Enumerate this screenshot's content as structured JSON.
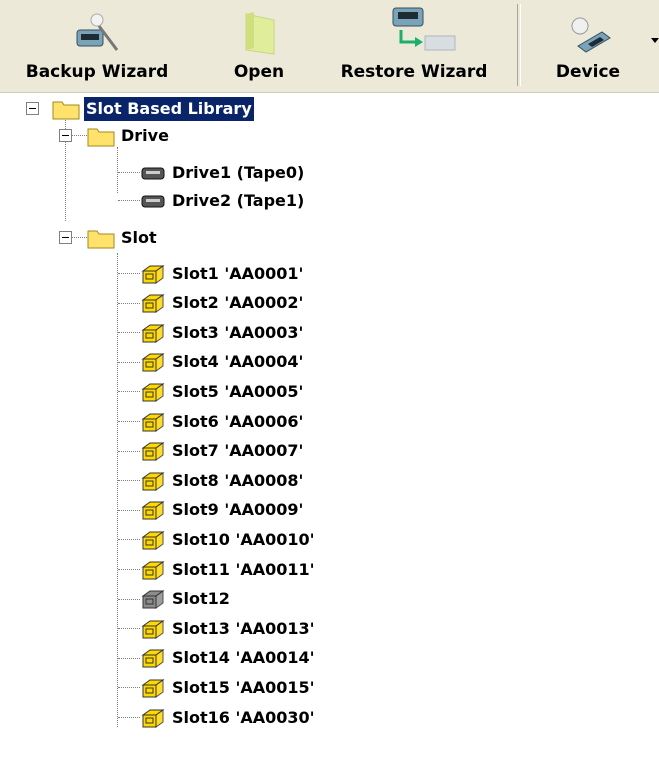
{
  "toolbar": {
    "backup_label": "Backup Wizard",
    "open_label": "Open",
    "restore_label": "Restore Wizard",
    "device_label": "Device"
  },
  "tree": {
    "root": {
      "label": "Slot Based Library",
      "icon": "folder-icon",
      "selected": true
    },
    "drive_group": {
      "label": "Drive",
      "icon": "folder-icon"
    },
    "drives": [
      {
        "label": "Drive1 (Tape0)",
        "icon": "tape-drive-icon"
      },
      {
        "label": "Drive2 (Tape1)",
        "icon": "tape-drive-icon"
      }
    ],
    "slot_group": {
      "label": "Slot",
      "icon": "folder-icon"
    },
    "slots": [
      {
        "label": "Slot1 'AA0001'",
        "icon": "tape-cartridge-icon",
        "color": "#ffd800"
      },
      {
        "label": "Slot2 'AA0002'",
        "icon": "tape-cartridge-icon",
        "color": "#ffd800"
      },
      {
        "label": "Slot3 'AA0003'",
        "icon": "tape-cartridge-icon",
        "color": "#ffd800"
      },
      {
        "label": "Slot4 'AA0004'",
        "icon": "tape-cartridge-icon",
        "color": "#ffd800"
      },
      {
        "label": "Slot5 'AA0005'",
        "icon": "tape-cartridge-icon",
        "color": "#ffd800"
      },
      {
        "label": "Slot6 'AA0006'",
        "icon": "tape-cartridge-icon",
        "color": "#ffd800"
      },
      {
        "label": "Slot7 'AA0007'",
        "icon": "tape-cartridge-icon",
        "color": "#ffd800"
      },
      {
        "label": "Slot8 'AA0008'",
        "icon": "tape-cartridge-icon",
        "color": "#ffd800"
      },
      {
        "label": "Slot9 'AA0009'",
        "icon": "tape-cartridge-icon",
        "color": "#ffd800"
      },
      {
        "label": "Slot10 'AA0010'",
        "icon": "tape-cartridge-icon",
        "color": "#ffd800"
      },
      {
        "label": "Slot11 'AA0011'",
        "icon": "tape-cartridge-icon",
        "color": "#ffd800"
      },
      {
        "label": "Slot12",
        "icon": "empty-slot-icon",
        "color": "#8c8c8c"
      },
      {
        "label": "Slot13 'AA0013'",
        "icon": "tape-cartridge-icon",
        "color": "#ffd800"
      },
      {
        "label": "Slot14 'AA0014'",
        "icon": "tape-cartridge-icon",
        "color": "#ffd800"
      },
      {
        "label": "Slot15 'AA0015'",
        "icon": "tape-cartridge-icon",
        "color": "#ffd800"
      },
      {
        "label": "Slot16 'AA0030'",
        "icon": "tape-cartridge-icon",
        "color": "#ffd800"
      }
    ]
  },
  "colors": {
    "toolbar_bg": "#ece9d8",
    "selection_bg": "#0a246a",
    "folder": "#ffe26b",
    "cartridge": "#ffd800"
  }
}
